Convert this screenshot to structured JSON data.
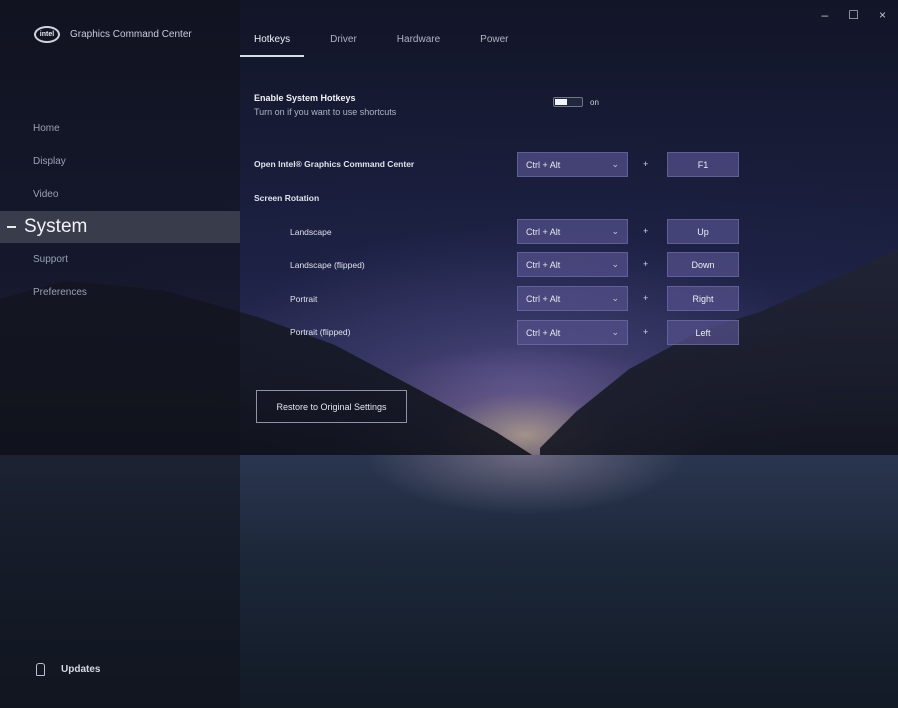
{
  "app": {
    "title": "Graphics Command Center",
    "logo_text": "intel"
  },
  "window_controls": {
    "minimize": "–",
    "maximize": "☐",
    "close": "×"
  },
  "sidebar": {
    "items": [
      {
        "label": "Home"
      },
      {
        "label": "Display"
      },
      {
        "label": "Video"
      },
      {
        "label": "System",
        "active": true
      },
      {
        "label": "Support"
      },
      {
        "label": "Preferences"
      }
    ],
    "updates_label": "Updates"
  },
  "tabs": [
    {
      "label": "Hotkeys",
      "active": true
    },
    {
      "label": "Driver"
    },
    {
      "label": "Hardware"
    },
    {
      "label": "Power"
    }
  ],
  "hotkeys": {
    "enable_title": "Enable System Hotkeys",
    "enable_subtitle": "Turn on if you want to use shortcuts",
    "toggle_state": "on",
    "open_gcc": {
      "label": "Open Intel® Graphics Command Center",
      "modifier": "Ctrl + Alt",
      "plus": "+",
      "key": "F1"
    },
    "screen_rotation_label": "Screen Rotation",
    "rotations": [
      {
        "label": "Landscape",
        "modifier": "Ctrl + Alt",
        "plus": "+",
        "key": "Up"
      },
      {
        "label": "Landscape (flipped)",
        "modifier": "Ctrl + Alt",
        "plus": "+",
        "key": "Down"
      },
      {
        "label": "Portrait",
        "modifier": "Ctrl + Alt",
        "plus": "+",
        "key": "Right"
      },
      {
        "label": "Portrait (flipped)",
        "modifier": "Ctrl + Alt",
        "plus": "+",
        "key": "Left"
      }
    ],
    "restore_label": "Restore to Original Settings"
  },
  "icons": {
    "chevron": "chevron-down-icon",
    "updates": "bell-icon"
  }
}
